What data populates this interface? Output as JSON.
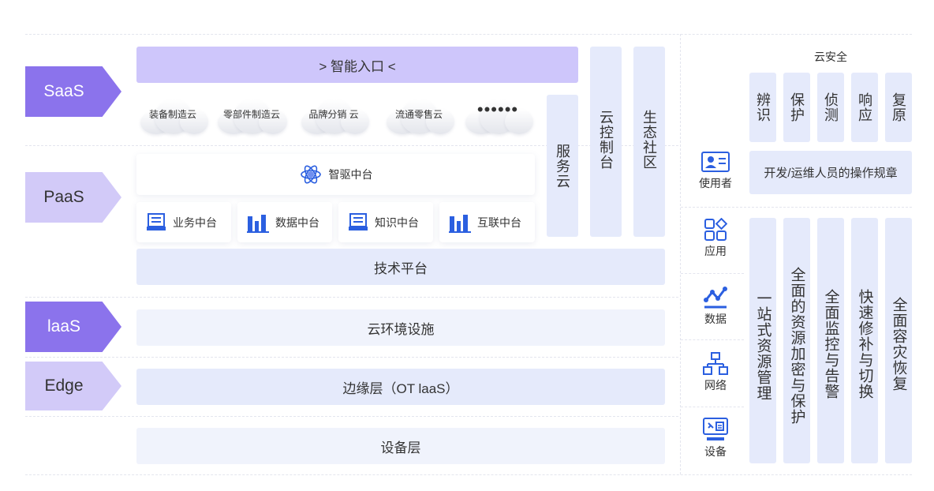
{
  "layers": {
    "saas": "SaaS",
    "paas": "PaaS",
    "iaas": "laaS",
    "edge": "Edge"
  },
  "saas": {
    "entry": "> 智能入口 <",
    "clouds": [
      "装备制造云",
      "零部件制造云",
      "品牌分销 云",
      "流通零售云",
      "••••••"
    ]
  },
  "paas": {
    "center": "智驱中台",
    "modules": [
      "业务中台",
      "数据中台",
      "知识中台",
      "互联中台"
    ],
    "tech_platform": "技术平台"
  },
  "infra": {
    "cloud_env": "云环境设施",
    "edge_layer": "边缘层（OT laaS）",
    "device_layer": "设备层"
  },
  "columns": {
    "service_cloud": "服务云",
    "cloud_console": "云控制台",
    "ecosystem": "生态社区"
  },
  "security": {
    "title": "云安全",
    "stages": [
      "辨识",
      "保护",
      "侦测",
      "响应",
      "复原"
    ],
    "ops_rule": "开发/运维人员的操作规章",
    "pillars": [
      "一站式资源管理",
      "全面的资源加密与保护",
      "全面监控与告警",
      "快速修补与切换",
      "全面容灾恢复"
    ]
  },
  "roles": {
    "user": "使用者",
    "app": "应用",
    "data": "数据",
    "network": "网络",
    "device": "设备"
  },
  "colors": {
    "accent": "#8b73ec",
    "accent_light": "#d2caf8",
    "bar_blue": "#e5eafb",
    "icon_blue": "#2b5fe0"
  }
}
